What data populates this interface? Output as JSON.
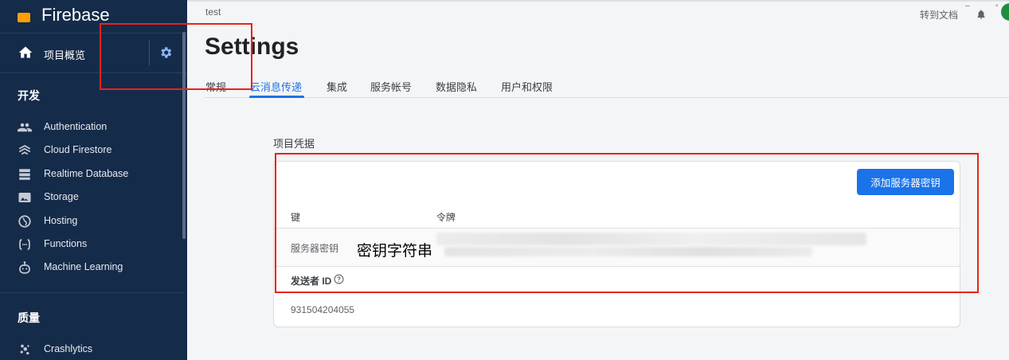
{
  "sidebar": {
    "brand": "Firebase",
    "overview_label": "项目概览",
    "section_build": "开发",
    "section_quality": "质量",
    "items": [
      {
        "label": "Authentication",
        "icon": "people-icon"
      },
      {
        "label": "Cloud Firestore",
        "icon": "firestore-icon"
      },
      {
        "label": "Realtime Database",
        "icon": "database-icon"
      },
      {
        "label": "Storage",
        "icon": "storage-icon"
      },
      {
        "label": "Hosting",
        "icon": "globe-icon"
      },
      {
        "label": "Functions",
        "icon": "functions-icon"
      },
      {
        "label": "Machine Learning",
        "icon": "robot-icon"
      }
    ],
    "quality_items": [
      {
        "label": "Crashlytics",
        "icon": "crashlytics-icon"
      }
    ]
  },
  "header": {
    "breadcrumb": "test",
    "docs_link": "转到文档",
    "title": "Settings"
  },
  "tabs": [
    {
      "label": "常规"
    },
    {
      "label": "云消息传递"
    },
    {
      "label": "集成"
    },
    {
      "label": "服务帐号"
    },
    {
      "label": "数据隐私"
    },
    {
      "label": "用户和权限"
    }
  ],
  "credentials": {
    "section_label": "项目凭据",
    "add_button": "添加服务器密钥",
    "col_key": "键",
    "col_token": "令牌",
    "server_key_label": "服务器密钥",
    "annotation": "密钥字符串",
    "sender_id_label": "发送者 ID",
    "sender_id_value": "931504204055"
  },
  "colors": {
    "sidebar_bg": "#152b4a",
    "accent": "#1a73e8",
    "highlight": "#e8221b"
  }
}
